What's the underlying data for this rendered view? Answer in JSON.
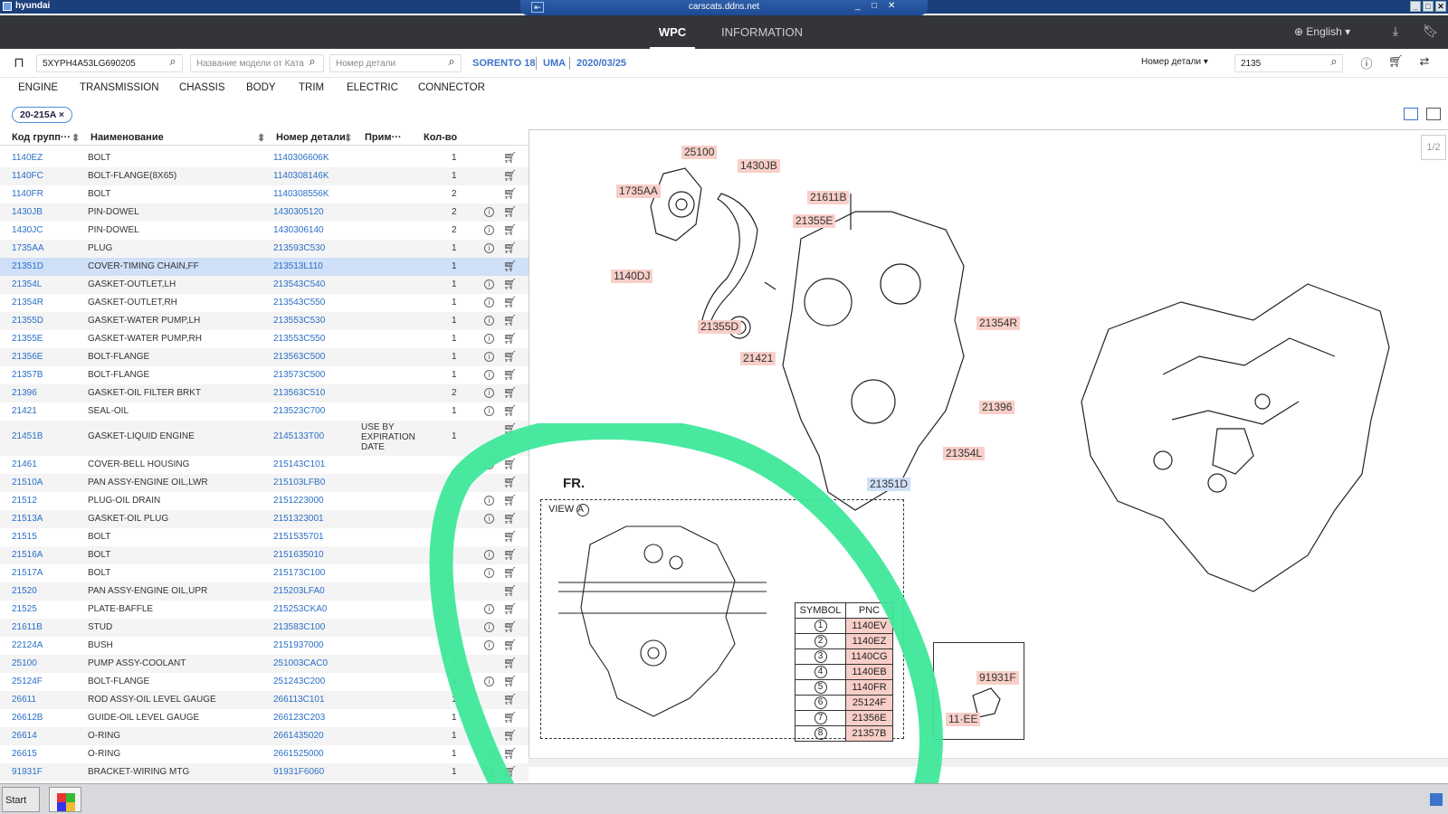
{
  "window": {
    "title": "hyundai",
    "remote_host": "carscats.ddns.net",
    "remote_pin": "⇤",
    "controls": [
      "_",
      "□",
      "✕"
    ]
  },
  "app": {
    "tabs": [
      "WPC",
      "INFORMATION"
    ],
    "active_tab": "WPC",
    "language": "English",
    "language_caret": "▾"
  },
  "toolbar": {
    "vin_value": "5XYPH4A53LG690205",
    "model_placeholder": "Название модели от Ката",
    "part_placeholder": "Номер детали",
    "vehicle": "SORENTO 18",
    "engine": "UMA",
    "date": "2020/03/25",
    "search_mode": "Номер детали",
    "search_value": "2135"
  },
  "categories": [
    "ENGINE",
    "TRANSMISSION",
    "CHASSIS",
    "BODY",
    "TRIM",
    "ELECTRIC",
    "CONNECTOR"
  ],
  "filter_chip": {
    "label": "20-215A",
    "close": "×"
  },
  "table": {
    "headers": [
      "Код групп···",
      "Наименование",
      "Номер детали",
      "Прим···",
      "Кол-во"
    ],
    "sort_glyph": "⬍",
    "rows": [
      {
        "code": "1140EZ",
        "name": "BOLT",
        "part": "1140306606K",
        "note": "",
        "qty": "1",
        "info": false
      },
      {
        "code": "1140FC",
        "name": "BOLT-FLANGE(8X65)",
        "part": "1140308146K",
        "note": "",
        "qty": "1",
        "info": false
      },
      {
        "code": "1140FR",
        "name": "BOLT",
        "part": "1140308556K",
        "note": "",
        "qty": "2",
        "info": false
      },
      {
        "code": "1430JB",
        "name": "PIN-DOWEL",
        "part": "1430305120",
        "note": "",
        "qty": "2",
        "info": true
      },
      {
        "code": "1430JC",
        "name": "PIN-DOWEL",
        "part": "1430306140",
        "note": "",
        "qty": "2",
        "info": true
      },
      {
        "code": "1735AA",
        "name": "PLUG",
        "part": "213593C530",
        "note": "",
        "qty": "1",
        "info": true
      },
      {
        "code": "21351D",
        "name": "COVER-TIMING CHAIN,FF",
        "part": "213513L110",
        "note": "",
        "qty": "1",
        "info": false,
        "selected": true
      },
      {
        "code": "21354L",
        "name": "GASKET-OUTLET,LH",
        "part": "213543C540",
        "note": "",
        "qty": "1",
        "info": true
      },
      {
        "code": "21354R",
        "name": "GASKET-OUTLET,RH",
        "part": "213543C550",
        "note": "",
        "qty": "1",
        "info": true
      },
      {
        "code": "21355D",
        "name": "GASKET-WATER PUMP,LH",
        "part": "213553C530",
        "note": "",
        "qty": "1",
        "info": true
      },
      {
        "code": "21355E",
        "name": "GASKET-WATER PUMP,RH",
        "part": "213553C550",
        "note": "",
        "qty": "1",
        "info": true
      },
      {
        "code": "21356E",
        "name": "BOLT-FLANGE",
        "part": "213563C500",
        "note": "",
        "qty": "1",
        "info": true
      },
      {
        "code": "21357B",
        "name": "BOLT-FLANGE",
        "part": "213573C500",
        "note": "",
        "qty": "1",
        "info": true
      },
      {
        "code": "21396",
        "name": "GASKET-OIL FILTER BRKT",
        "part": "213563C510",
        "note": "",
        "qty": "2",
        "info": true
      },
      {
        "code": "21421",
        "name": "SEAL-OIL",
        "part": "213523C700",
        "note": "",
        "qty": "1",
        "info": true
      },
      {
        "code": "21451B",
        "name": "GASKET-LIQUID ENGINE",
        "part": "2145133T00",
        "note": "USE BY EXPIRATION DATE",
        "qty": "1",
        "info": false,
        "tall": true
      },
      {
        "code": "21461",
        "name": "COVER-BELL HOUSING",
        "part": "215143C101",
        "note": "",
        "qty": "",
        "info": true
      },
      {
        "code": "21510A",
        "name": "PAN ASSY-ENGINE OIL,LWR",
        "part": "215103LFB0",
        "note": "",
        "qty": "",
        "info": false
      },
      {
        "code": "21512",
        "name": "PLUG-OIL DRAIN",
        "part": "2151223000",
        "note": "",
        "qty": "",
        "info": true
      },
      {
        "code": "21513A",
        "name": "GASKET-OIL PLUG",
        "part": "2151323001",
        "note": "",
        "qty": "",
        "info": true
      },
      {
        "code": "21515",
        "name": "BOLT",
        "part": "2151535701",
        "note": "",
        "qty": "",
        "info": false
      },
      {
        "code": "21516A",
        "name": "BOLT",
        "part": "2151635010",
        "note": "",
        "qty": "",
        "info": true
      },
      {
        "code": "21517A",
        "name": "BOLT",
        "part": "215173C100",
        "note": "",
        "qty": "",
        "info": true
      },
      {
        "code": "21520",
        "name": "PAN ASSY-ENGINE OIL,UPR",
        "part": "215203LFA0",
        "note": "",
        "qty": "",
        "info": false
      },
      {
        "code": "21525",
        "name": "PLATE-BAFFLE",
        "part": "215253CKA0",
        "note": "",
        "qty": "",
        "info": true
      },
      {
        "code": "21611B",
        "name": "STUD",
        "part": "213583C100",
        "note": "",
        "qty": "",
        "info": true
      },
      {
        "code": "22124A",
        "name": "BUSH",
        "part": "2151937000",
        "note": "",
        "qty": "",
        "info": true
      },
      {
        "code": "25100",
        "name": "PUMP ASSY-COOLANT",
        "part": "251003CAC0",
        "note": "",
        "qty": "1",
        "info": false
      },
      {
        "code": "25124F",
        "name": "BOLT-FLANGE",
        "part": "251243C200",
        "note": "",
        "qty": "4",
        "info": true
      },
      {
        "code": "26611",
        "name": "ROD ASSY-OIL LEVEL GAUGE",
        "part": "266113C101",
        "note": "",
        "qty": "1",
        "info": false
      },
      {
        "code": "26612B",
        "name": "GUIDE-OIL LEVEL GAUGE",
        "part": "266123C203",
        "note": "",
        "qty": "1",
        "info": false
      },
      {
        "code": "26614",
        "name": "O-RING",
        "part": "2661435020",
        "note": "",
        "qty": "1",
        "info": false
      },
      {
        "code": "26615",
        "name": "O-RING",
        "part": "2661525000",
        "note": "",
        "qty": "1",
        "info": true
      },
      {
        "code": "91931F",
        "name": "BRACKET-WIRING MTG",
        "part": "91931F6060",
        "note": "",
        "qty": "1",
        "info": true
      }
    ]
  },
  "diagram": {
    "page": "1/2",
    "fr_label": "FR.",
    "view_label": "VIEW",
    "view_letter": "A",
    "callouts": [
      {
        "id": "25100"
      },
      {
        "id": "1430JB"
      },
      {
        "id": "1735AA"
      },
      {
        "id": "21611B"
      },
      {
        "id": "21355E"
      },
      {
        "id": "1140DJ"
      },
      {
        "id": "21355D"
      },
      {
        "id": "21421"
      },
      {
        "id": "21354R"
      },
      {
        "id": "21396"
      },
      {
        "id": "21354L"
      },
      {
        "id": "21351D",
        "highlight": true
      },
      {
        "id": "91931F"
      },
      {
        "id": "11·EE"
      }
    ],
    "symbol_table": {
      "headers": [
        "SYMBOL",
        "PNC"
      ],
      "rows": [
        {
          "sym": "1",
          "pnc": "1140EV"
        },
        {
          "sym": "2",
          "pnc": "1140EZ"
        },
        {
          "sym": "3",
          "pnc": "1140CG"
        },
        {
          "sym": "4",
          "pnc": "1140EB"
        },
        {
          "sym": "5",
          "pnc": "1140FR"
        },
        {
          "sym": "6",
          "pnc": "25124F"
        },
        {
          "sym": "7",
          "pnc": "21356E"
        },
        {
          "sym": "8",
          "pnc": "21357B"
        }
      ]
    }
  },
  "taskbar": {
    "start_label": "Start"
  },
  "colors": {
    "accent": "#3d74c9",
    "callout_bg": "#f8cfc8",
    "selected_row": "#cfe0f8",
    "annotation": "#3ee89a"
  }
}
